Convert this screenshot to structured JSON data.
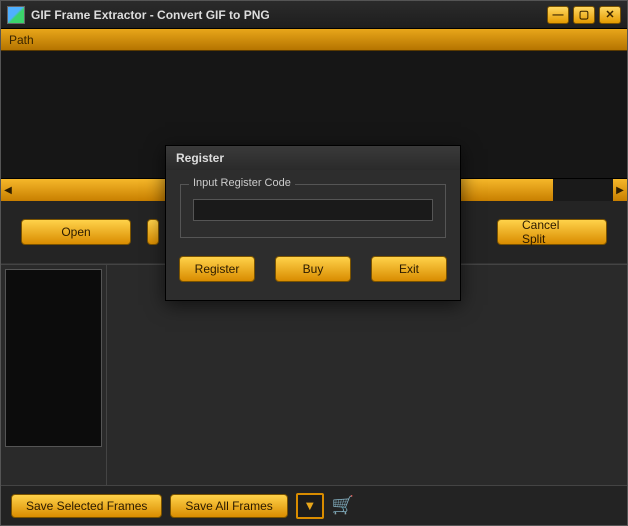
{
  "titlebar": {
    "title": "GIF Frame Extractor - Convert GIF to PNG"
  },
  "pathbar": {
    "label": "Path"
  },
  "toolbar": {
    "open_label": "Open",
    "cancel_label": "Cancel Split"
  },
  "footer": {
    "save_selected_label": "Save Selected Frames",
    "save_all_label": "Save All Frames"
  },
  "dialog": {
    "title": "Register",
    "group_label": "Input  Register Code",
    "code_value": "",
    "register_label": "Register",
    "buy_label": "Buy",
    "exit_label": "Exit"
  },
  "icons": {
    "minimize": "—",
    "maximize": "▢",
    "close": "✕",
    "strip_left": "◀",
    "strip_right": "▶",
    "dropdown": "▼",
    "cart": "🛒"
  }
}
